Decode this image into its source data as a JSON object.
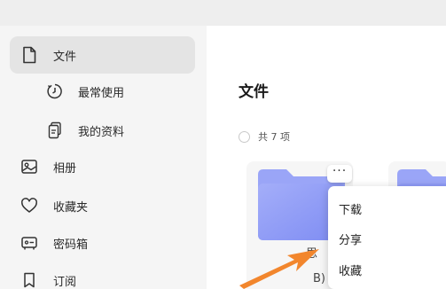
{
  "sidebar": {
    "items": [
      {
        "label": "文件",
        "icon": "file-icon"
      },
      {
        "label": "最常使用",
        "icon": "clock-icon"
      },
      {
        "label": "我的资料",
        "icon": "documents-icon"
      },
      {
        "label": "相册",
        "icon": "photo-album-icon"
      },
      {
        "label": "收藏夹",
        "icon": "heart-icon"
      },
      {
        "label": "密码箱",
        "icon": "safe-icon"
      },
      {
        "label": "订阅",
        "icon": "bookmark-icon"
      }
    ]
  },
  "main": {
    "title": "文件",
    "count_text": "共 7 项",
    "more_label": "···",
    "card_fragments": [
      "思",
      "B)"
    ]
  },
  "context_menu": {
    "items": [
      "下载",
      "分享",
      "收藏"
    ]
  },
  "colors": {
    "accent_folder": "#8f9cf7",
    "arrow": "#f2862d",
    "active_bg": "#e4e4e4"
  }
}
